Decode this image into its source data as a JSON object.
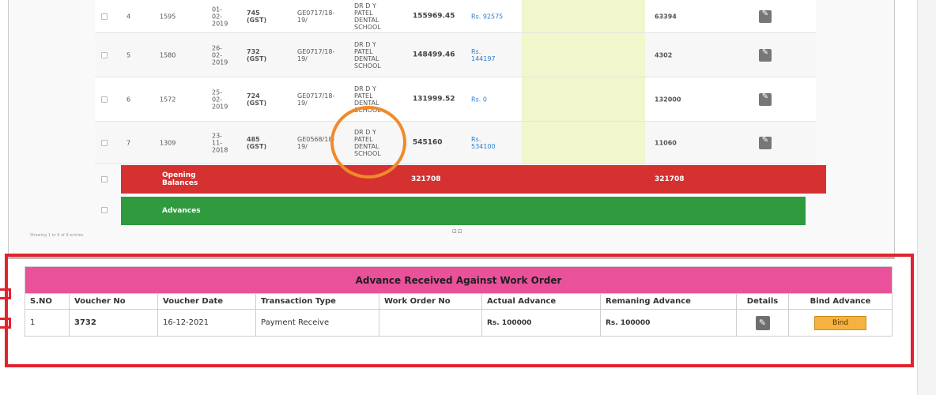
{
  "invoice_rows": [
    {
      "sno": "4",
      "no": "1595",
      "date": "01-\n02-\n2019",
      "bill": "745\n(GST)",
      "po": "GE0717/18-\n19/",
      "party": "DR D Y\nPATEL\nDENTAL\nSCHOOL",
      "amount": "155969.45",
      "received": "Rs. 92575",
      "balance": "63394"
    },
    {
      "sno": "5",
      "no": "1580",
      "date": "26-\n02-\n2019",
      "bill": "732\n(GST)",
      "po": "GE0717/18-\n19/",
      "party": "DR D Y\nPATEL\nDENTAL\nSCHOOL",
      "amount": "148499.46",
      "received": "Rs.\n144197",
      "balance": "4302"
    },
    {
      "sno": "6",
      "no": "1572",
      "date": "25-\n02-\n2019",
      "bill": "724\n(GST)",
      "po": "GE0717/18-\n19/",
      "party": "DR D Y\nPATEL\nDENTAL\nSCHOOL",
      "amount": "131999.52",
      "received": "Rs. 0",
      "balance": "132000"
    },
    {
      "sno": "7",
      "no": "1309",
      "date": "23-\n11-\n2018",
      "bill": "485\n(GST)",
      "po": "GE0568/18-\n19/",
      "party": "DR D Y\nPATEL\nDENTAL\nSCHOOL",
      "amount": "545160",
      "received": "Rs.\n534100",
      "balance": "11060"
    }
  ],
  "opening": {
    "label": "Opening\nBalances",
    "amount": "321708",
    "balance": "321708"
  },
  "advances": {
    "label": "Advances"
  },
  "info": "Showing 1 to 9 of 9 entries",
  "pager": "⊡⊡",
  "advance_section": {
    "title": "Advance Received Against Work Order",
    "headers": [
      "S.NO",
      "Voucher No",
      "Voucher Date",
      "Transaction Type",
      "Work Order No",
      "Actual Advance",
      "Remaning Advance",
      "Details",
      "Bind Advance"
    ],
    "row": {
      "sno": "1",
      "voucher_no": "3732",
      "voucher_date": "16-12-2021",
      "type": "Payment Receive",
      "work_order": "",
      "actual": "Rs. 100000",
      "remaining": "Rs. 100000",
      "bind_label": "Bind"
    }
  },
  "colors": {
    "red": "#d63131",
    "green": "#2f9a3e",
    "pink": "#e9519a",
    "orange": "#f08a2b",
    "yellow": "#f2f6cc"
  },
  "icons": {
    "edit": "edit-icon"
  }
}
